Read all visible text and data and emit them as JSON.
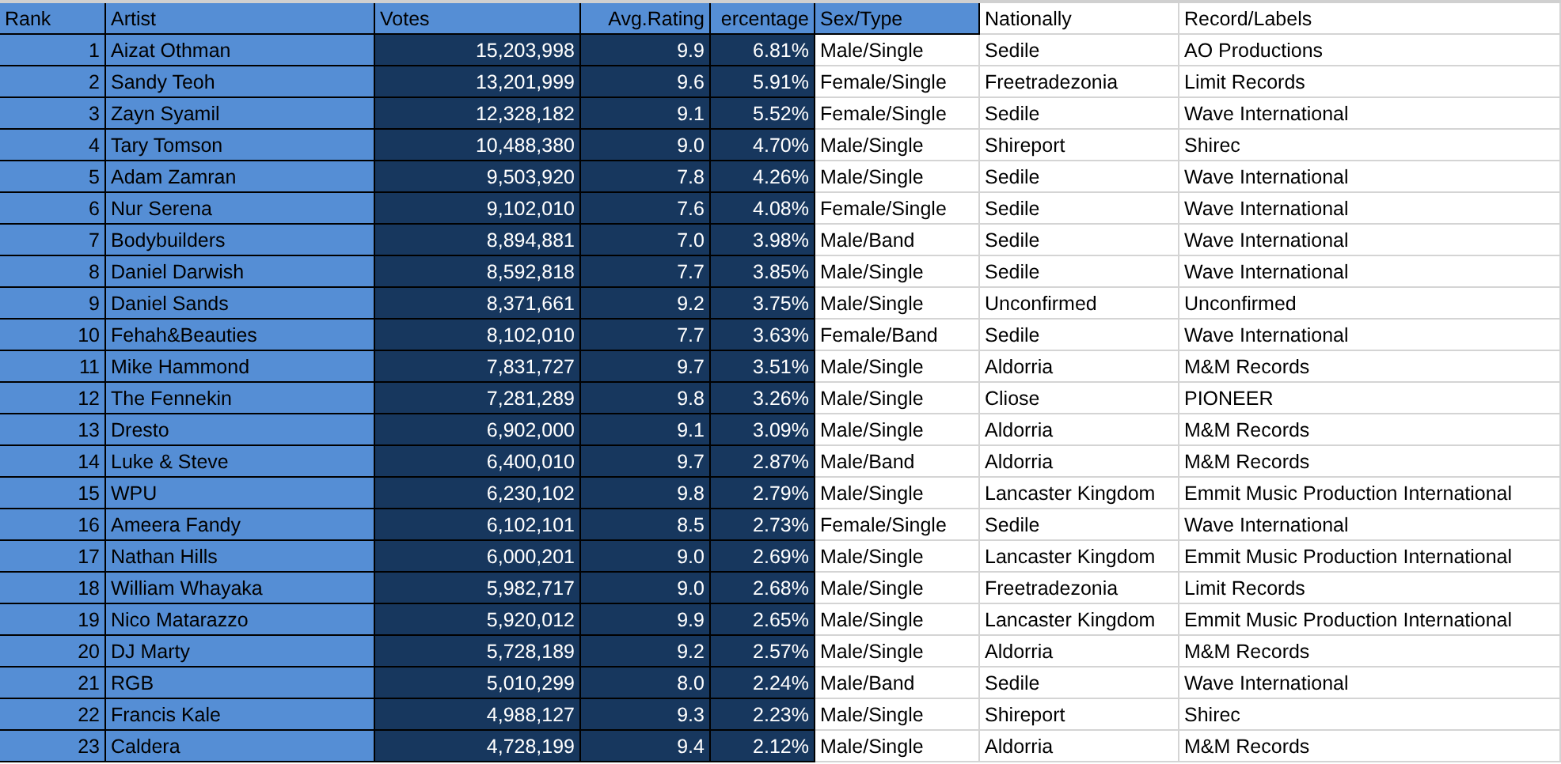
{
  "table": {
    "columns": [
      {
        "label": "Rank",
        "kind": "accent-number",
        "header_right": false
      },
      {
        "label": "Artist",
        "kind": "accent",
        "header_right": false
      },
      {
        "label": "Votes",
        "kind": "dark-number",
        "header_right": false
      },
      {
        "label": "Avg.Rating",
        "kind": "dark-number",
        "header_right": true
      },
      {
        "label": "ercentage",
        "kind": "dark-number",
        "header_right": true
      },
      {
        "label": "Sex/Type",
        "kind": "accent-head",
        "header_right": false
      },
      {
        "label": "Nationally",
        "kind": "plain",
        "header_right": false
      },
      {
        "label": "Record/Labels",
        "kind": "plain",
        "header_right": false
      }
    ],
    "rows": [
      [
        "1",
        "Aizat Othman",
        "15,203,998",
        "9.9",
        "6.81%",
        "Male/Single",
        "Sedile",
        "AO Productions"
      ],
      [
        "2",
        "Sandy Teoh",
        "13,201,999",
        "9.6",
        "5.91%",
        "Female/Single",
        "Freetradezonia",
        "Limit Records"
      ],
      [
        "3",
        "Zayn Syamil",
        "12,328,182",
        "9.1",
        "5.52%",
        "Female/Single",
        "Sedile",
        "Wave International"
      ],
      [
        "4",
        "Tary Tomson",
        "10,488,380",
        "9.0",
        "4.70%",
        "Male/Single",
        "Shireport",
        "Shirec"
      ],
      [
        "5",
        "Adam Zamran",
        "9,503,920",
        "7.8",
        "4.26%",
        "Male/Single",
        "Sedile",
        "Wave International"
      ],
      [
        "6",
        "Nur Serena",
        "9,102,010",
        "7.6",
        "4.08%",
        "Female/Single",
        "Sedile",
        "Wave International"
      ],
      [
        "7",
        "Bodybuilders",
        "8,894,881",
        "7.0",
        "3.98%",
        "Male/Band",
        "Sedile",
        "Wave International"
      ],
      [
        "8",
        "Daniel Darwish",
        "8,592,818",
        "7.7",
        "3.85%",
        "Male/Single",
        "Sedile",
        "Wave International"
      ],
      [
        "9",
        "Daniel Sands",
        "8,371,661",
        "9.2",
        "3.75%",
        "Male/Single",
        "Unconfirmed",
        "Unconfirmed"
      ],
      [
        "10",
        "Fehah&Beauties",
        "8,102,010",
        "7.7",
        "3.63%",
        "Female/Band",
        "Sedile",
        "Wave International"
      ],
      [
        "11",
        "Mike Hammond",
        "7,831,727",
        "9.7",
        "3.51%",
        "Male/Single",
        "Aldorria",
        "M&M Records"
      ],
      [
        "12",
        "The Fennekin",
        "7,281,289",
        "9.8",
        "3.26%",
        "Male/Single",
        "Cliose",
        "PIONEER"
      ],
      [
        "13",
        "Dresto",
        "6,902,000",
        "9.1",
        "3.09%",
        "Male/Single",
        "Aldorria",
        "M&M Records"
      ],
      [
        "14",
        "Luke & Steve",
        "6,400,010",
        "9.7",
        "2.87%",
        "Male/Band",
        "Aldorria",
        "M&M Records"
      ],
      [
        "15",
        "WPU",
        "6,230,102",
        "9.8",
        "2.79%",
        "Male/Single",
        "Lancaster Kingdom",
        "Emmit Music Production International"
      ],
      [
        "16",
        "Ameera Fandy",
        "6,102,101",
        "8.5",
        "2.73%",
        "Female/Single",
        "Sedile",
        "Wave International"
      ],
      [
        "17",
        "Nathan Hills",
        "6,000,201",
        "9.0",
        "2.69%",
        "Male/Single",
        "Lancaster Kingdom",
        "Emmit Music Production International"
      ],
      [
        "18",
        "William Whayaka",
        "5,982,717",
        "9.0",
        "2.68%",
        "Male/Single",
        "Freetradezonia",
        "Limit Records"
      ],
      [
        "19",
        "Nico Matarazzo",
        "5,920,012",
        "9.9",
        "2.65%",
        "Male/Single",
        "Lancaster Kingdom",
        "Emmit Music Production International"
      ],
      [
        "20",
        "DJ Marty",
        "5,728,189",
        "9.2",
        "2.57%",
        "Male/Single",
        "Aldorria",
        "M&M Records"
      ],
      [
        "21",
        "RGB",
        "5,010,299",
        "8.0",
        "2.24%",
        "Male/Band",
        "Sedile",
        "Wave International"
      ],
      [
        "22",
        "Francis Kale",
        "4,988,127",
        "9.3",
        "2.23%",
        "Male/Single",
        "Shireport",
        "Shirec"
      ],
      [
        "23",
        "Caldera",
        "4,728,199",
        "9.4",
        "2.12%",
        "Male/Single",
        "Aldorria",
        "M&M Records"
      ]
    ]
  }
}
